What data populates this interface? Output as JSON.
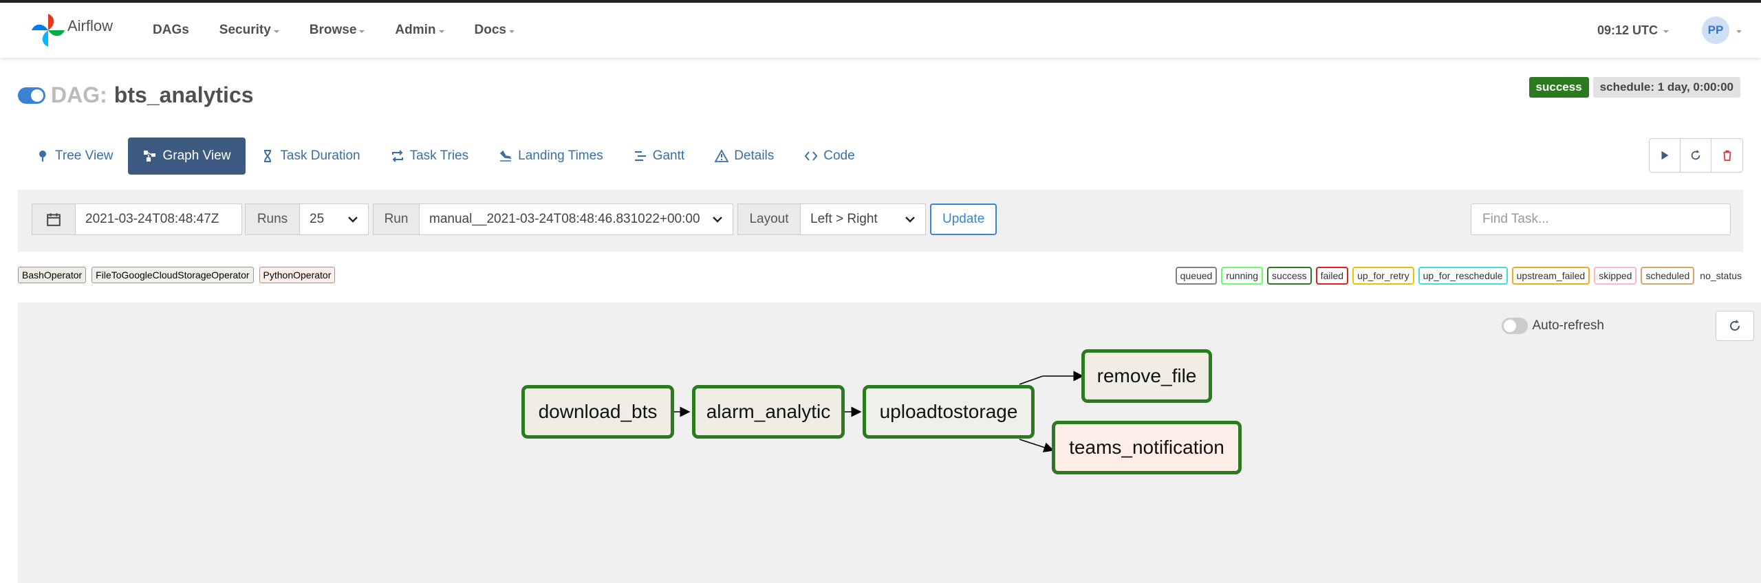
{
  "navbar": {
    "brand": "Airflow",
    "items": [
      {
        "label": "DAGs",
        "dropdown": false
      },
      {
        "label": "Security",
        "dropdown": true
      },
      {
        "label": "Browse",
        "dropdown": true
      },
      {
        "label": "Admin",
        "dropdown": true
      },
      {
        "label": "Docs",
        "dropdown": true
      }
    ],
    "clock": "09:12 UTC",
    "user_initials": "PP"
  },
  "dag": {
    "label": "DAG:",
    "name": "bts_analytics",
    "paused": false,
    "status": "success",
    "schedule": "schedule: 1 day, 0:00:00"
  },
  "tabs": [
    {
      "label": "Tree View",
      "icon": "tree-icon",
      "active": false
    },
    {
      "label": "Graph View",
      "icon": "graph-icon",
      "active": true
    },
    {
      "label": "Task Duration",
      "icon": "hourglass-icon",
      "active": false
    },
    {
      "label": "Task Tries",
      "icon": "retry-icon",
      "active": false
    },
    {
      "label": "Landing Times",
      "icon": "landing-icon",
      "active": false
    },
    {
      "label": "Gantt",
      "icon": "gantt-icon",
      "active": false
    },
    {
      "label": "Details",
      "icon": "warning-icon",
      "active": false
    },
    {
      "label": "Code",
      "icon": "code-icon",
      "active": false
    }
  ],
  "filters": {
    "base_date": "2021-03-24T08:48:47Z",
    "runs_label": "Runs",
    "runs_value": "25",
    "run_label": "Run",
    "run_value": "manual__2021-03-24T08:48:46.831022+00:00",
    "layout_label": "Layout",
    "layout_value": "Left > Right",
    "update_label": "Update",
    "find_task_placeholder": "Find Task..."
  },
  "operators": [
    {
      "label": "BashOperator",
      "color": "#f0ede4"
    },
    {
      "label": "FileToGoogleCloudStorageOperator",
      "color": "#f0f0ea"
    },
    {
      "label": "PythonOperator",
      "color": "#fdeee7"
    }
  ],
  "states": [
    {
      "label": "queued",
      "color": "#808080"
    },
    {
      "label": "running",
      "color": "#66ff66"
    },
    {
      "label": "success",
      "color": "#2c7a1f"
    },
    {
      "label": "failed",
      "color": "#e02020"
    },
    {
      "label": "up_for_retry",
      "color": "#f0c000"
    },
    {
      "label": "up_for_reschedule",
      "color": "#40e0d0"
    },
    {
      "label": "upstream_failed",
      "color": "#f5a623"
    },
    {
      "label": "skipped",
      "color": "#ffb6c1"
    },
    {
      "label": "scheduled",
      "color": "#d2a56d"
    }
  ],
  "no_status_label": "no_status",
  "graph": {
    "auto_refresh_label": "Auto-refresh",
    "auto_refresh_on": false,
    "tasks": [
      {
        "id": "download_bts",
        "label": "download_bts",
        "operator": "BashOperator",
        "state": "success"
      },
      {
        "id": "alarm_analytic",
        "label": "alarm_analytic",
        "operator": "BashOperator",
        "state": "success"
      },
      {
        "id": "uploadtostorage",
        "label": "uploadtostorage",
        "operator": "FileToGoogleCloudStorageOperator",
        "state": "success"
      },
      {
        "id": "remove_file",
        "label": "remove_file",
        "operator": "BashOperator",
        "state": "success"
      },
      {
        "id": "teams_notification",
        "label": "teams_notification",
        "operator": "PythonOperator",
        "state": "success"
      }
    ],
    "edges": [
      [
        "download_bts",
        "alarm_analytic"
      ],
      [
        "alarm_analytic",
        "uploadtostorage"
      ],
      [
        "uploadtostorage",
        "remove_file"
      ],
      [
        "uploadtostorage",
        "teams_notification"
      ]
    ]
  }
}
